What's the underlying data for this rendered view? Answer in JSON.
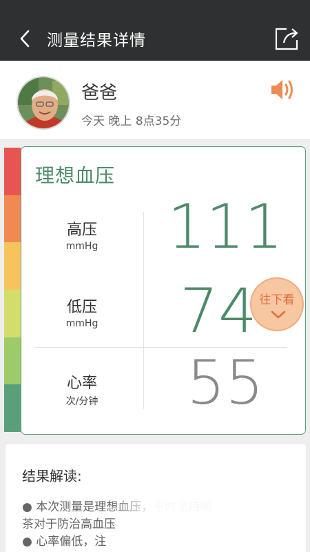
{
  "header": {
    "title": "测量结果详情",
    "back_icon": "chevron-left-icon",
    "share_icon": "share-icon"
  },
  "profile": {
    "name": "爸爸",
    "time": "今天  晚上 8点35分",
    "speaker_icon": "speaker-icon"
  },
  "measurement": {
    "level": "理想血压",
    "systolic": {
      "label": "高压",
      "unit": "mmHg",
      "value": "111"
    },
    "diastolic": {
      "label": "低压",
      "unit": "mmHg",
      "value": "74"
    },
    "heart_rate": {
      "label": "心率",
      "unit": "次/分钟",
      "value": "55"
    }
  },
  "scroll_hint": {
    "label": "往下看",
    "icon": "chevron-down-icon"
  },
  "scale_colors": [
    "#e85451",
    "#f08a52",
    "#f6c35c",
    "#d3dd6c",
    "#9dcb6a",
    "#5b9f7a"
  ],
  "colors": {
    "accent": "#4d8a69",
    "orange": "#f08a52",
    "header_bg": "#2f3031"
  },
  "result": {
    "heading": "结果解读:",
    "lines": [
      "● 本次测量是理想血压，平时坚持喝",
      "茶对于防治高血压",
      "● 心率偏低，注"
    ]
  }
}
